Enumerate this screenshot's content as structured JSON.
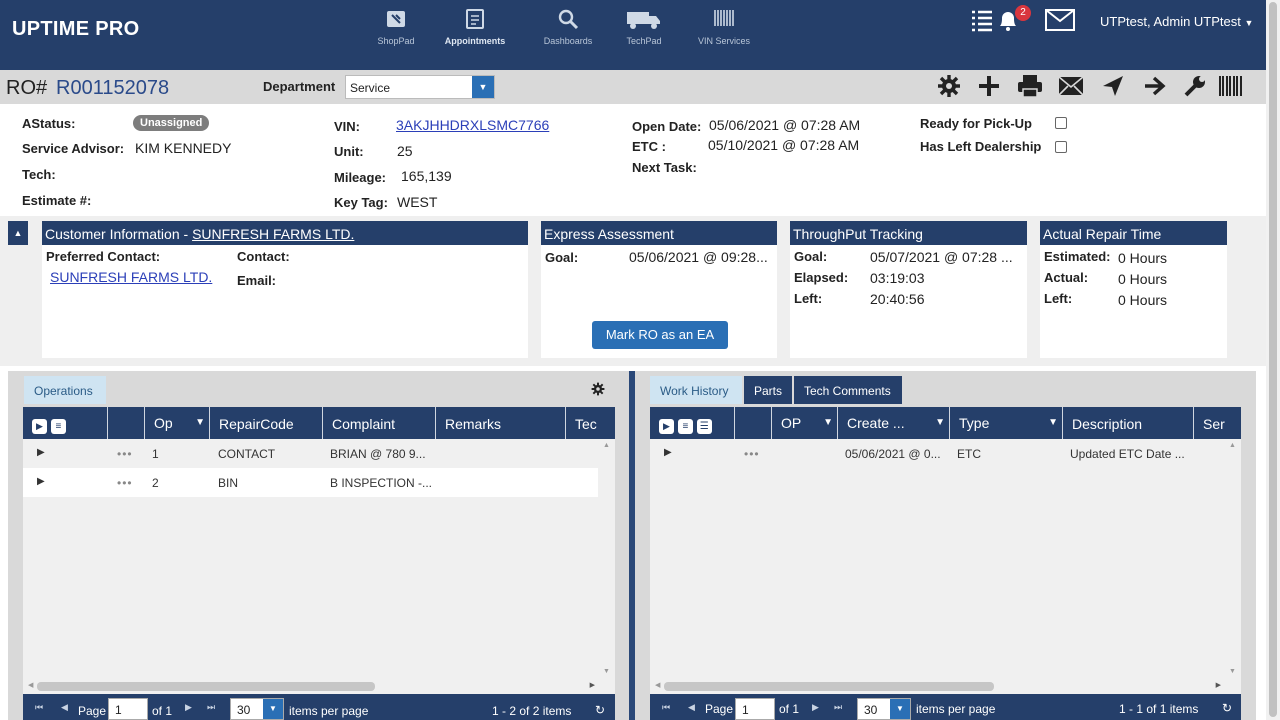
{
  "app": {
    "title": "UPTIME PRO"
  },
  "nav": {
    "items": [
      {
        "label": "ShopPad",
        "icon": "shoppad-icon"
      },
      {
        "label": "Appointments",
        "icon": "appointments-icon"
      },
      {
        "label": "Dashboards",
        "icon": "dashboards-icon"
      },
      {
        "label": "TechPad",
        "icon": "techpad-icon"
      },
      {
        "label": "VIN Services",
        "icon": "barcode-icon"
      }
    ],
    "notification_count": "2",
    "user": "UTPtest, Admin UTPtest"
  },
  "ro": {
    "label": "RO#",
    "number": "R001152078",
    "department_label": "Department",
    "department_value": "Service"
  },
  "details": {
    "astatus_label": "AStatus:",
    "astatus_value": "Unassigned",
    "advisor_label": "Service Advisor:",
    "advisor_value": "KIM KENNEDY",
    "tech_label": "Tech:",
    "estimate_label": "Estimate #:",
    "vin_label": "VIN:",
    "vin_value": "3AKJHHDRXLSMC7766",
    "unit_label": "Unit:",
    "unit_value": "25",
    "mileage_label": "Mileage:",
    "mileage_value": "165,139",
    "keytag_label": "Key Tag:",
    "keytag_value": "WEST",
    "open_label": "Open Date:",
    "open_value": "05/06/2021 @ 07:28 AM",
    "etc_label": "ETC :",
    "etc_value": "05/10/2021 @ 07:28 AM",
    "next_label": "Next Task:",
    "ready_label": "Ready for Pick-Up",
    "left_label": "Has Left Dealership"
  },
  "customer": {
    "title": "Customer Information -",
    "name": "SUNFRESH FARMS LTD.",
    "preferred_label": "Preferred Contact:",
    "preferred_value": "SUNFRESH FARMS LTD.",
    "contact_label": "Contact:",
    "email_label": "Email:"
  },
  "express": {
    "title": "Express Assessment",
    "goal_label": "Goal:",
    "goal_value": "05/06/2021 @ 09:28...",
    "button": "Mark RO as an EA"
  },
  "throughput": {
    "title": "ThroughPut Tracking",
    "goal_label": "Goal:",
    "goal_value": "05/07/2021 @ 07:28 ...",
    "elapsed_label": "Elapsed:",
    "elapsed_value": "03:19:03",
    "left_label": "Left:",
    "left_value": "20:40:56"
  },
  "repair_time": {
    "title": "Actual Repair Time",
    "estimated_label": "Estimated:",
    "estimated_value": "0 Hours",
    "actual_label": "Actual:",
    "actual_value": "0 Hours",
    "left_label": "Left:",
    "left_value": "0 Hours"
  },
  "operations": {
    "tab": "Operations",
    "columns": [
      "Op",
      "RepairCode",
      "Complaint",
      "Remarks",
      "Tec"
    ],
    "rows": [
      {
        "op": "1",
        "code": "CONTACT",
        "complaint": "BRIAN @ 780 9..."
      },
      {
        "op": "2",
        "code": "BIN",
        "complaint": "B INSPECTION -..."
      }
    ],
    "pager": {
      "page_label": "Page",
      "page": "1",
      "of": "of 1",
      "per_page": "30",
      "per_label": "items per page",
      "summary": "1 - 2 of 2 items"
    }
  },
  "history": {
    "tabs": [
      "Work History",
      "Parts",
      "Tech Comments"
    ],
    "columns": [
      "OP",
      "Create ...",
      "Type",
      "Description",
      "Ser"
    ],
    "rows": [
      {
        "create": "05/06/2021 @ 0...",
        "type": "ETC",
        "description": "Updated ETC Date ..."
      }
    ],
    "pager": {
      "page_label": "Page",
      "page": "1",
      "of": "of 1",
      "per_page": "30",
      "per_label": "items per page",
      "summary": "1 - 1 of 1 items"
    }
  },
  "colors": {
    "navy": "#253f6a",
    "accent": "#2a6fb5",
    "link": "#2b3fb8",
    "badge": "#d9363e"
  }
}
